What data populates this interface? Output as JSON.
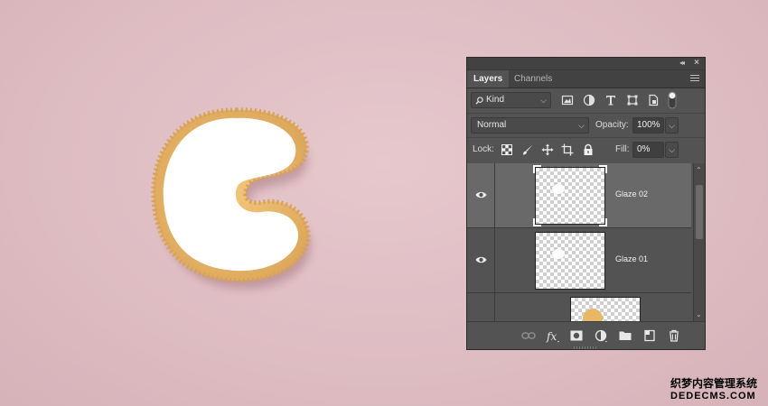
{
  "panel": {
    "tabs": [
      {
        "label": "Layers",
        "active": true
      },
      {
        "label": "Channels",
        "active": false
      }
    ],
    "filter": {
      "kind_label": "Kind",
      "icons": [
        "pixel-filter-icon",
        "adjustment-filter-icon",
        "type-filter-icon",
        "shape-filter-icon",
        "smart-object-filter-icon",
        "filter-toggle-icon"
      ]
    },
    "blend": {
      "mode": "Normal",
      "opacity_label": "Opacity:",
      "opacity_value": "100%"
    },
    "lock": {
      "label": "Lock:",
      "fill_label": "Fill:",
      "fill_value": "0%"
    },
    "layers": [
      {
        "name": "Glaze 02",
        "selected": true,
        "visible": true
      },
      {
        "name": "Glaze 01",
        "selected": false,
        "visible": true
      },
      {
        "name": "",
        "selected": false,
        "visible": true
      }
    ],
    "bottom_icons": [
      "link-layers-icon",
      "fx-icon",
      "add-mask-icon",
      "adjustment-layer-icon",
      "new-group-icon",
      "new-layer-icon",
      "delete-layer-icon"
    ]
  },
  "canvas": {
    "letter": "C",
    "glaze_color": "#ffffff",
    "cookie_color": "#e8b867",
    "background": "#e0c1c7"
  },
  "watermark": {
    "cn": "织梦内容管理系统",
    "en": "DEDECMS.COM"
  }
}
